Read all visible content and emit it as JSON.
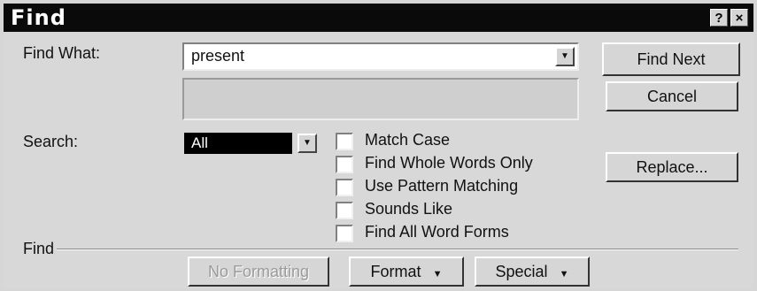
{
  "window": {
    "title": "Find",
    "help_label": "?",
    "close_label": "×"
  },
  "find_what": {
    "label": "Find What:",
    "value": "present"
  },
  "search": {
    "label": "Search:",
    "value": "All"
  },
  "options": [
    {
      "label": "Match Case",
      "checked": false
    },
    {
      "label": "Find Whole Words Only",
      "checked": false
    },
    {
      "label": "Use Pattern Matching",
      "checked": false
    },
    {
      "label": "Sounds Like",
      "checked": false
    },
    {
      "label": "Find All Word Forms",
      "checked": false
    }
  ],
  "buttons": {
    "find_next": "Find Next",
    "cancel": "Cancel",
    "replace": "Replace..."
  },
  "find_section": {
    "label": "Find",
    "no_formatting": "No Formatting",
    "format": "Format",
    "special": "Special"
  },
  "icons": {
    "dropdown": "chevron-down-icon",
    "help": "help-icon",
    "close": "close-icon"
  }
}
